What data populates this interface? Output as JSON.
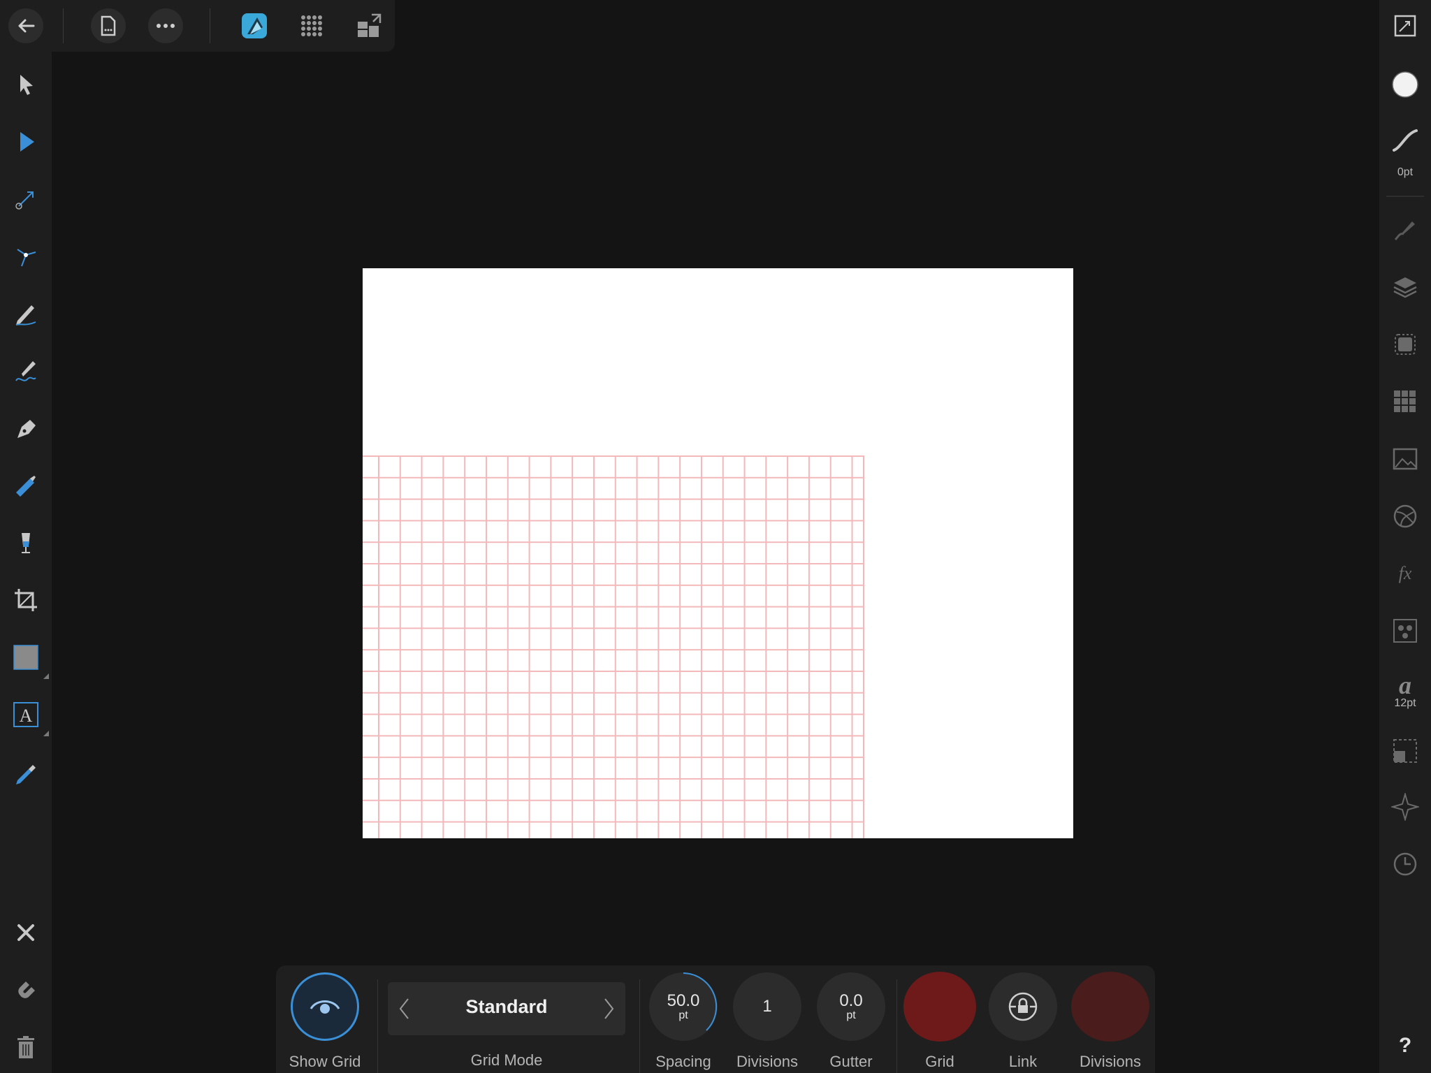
{
  "app": {
    "accent": "#3aa8d8"
  },
  "top_toolbar": {
    "icons": [
      "back-arrow-icon",
      "document-icon",
      "more-icon",
      "designer-persona-icon",
      "pixel-persona-icon",
      "export-persona-icon"
    ]
  },
  "left_tools": {
    "icons": [
      "move-tool-icon",
      "node-tool-icon",
      "contour-tool-icon",
      "corner-tool-icon",
      "pencil-tool-icon",
      "vector-brush-icon",
      "pen-tool-icon",
      "fill-tool-icon",
      "transparency-tool-icon",
      "crop-tool-icon",
      "rectangle-tool-icon",
      "artistic-text-icon",
      "color-picker-icon",
      "close-icon",
      "snapping-magnet-icon",
      "delete-icon"
    ]
  },
  "right_studio": {
    "stroke_width": "0pt",
    "font_size": "12pt",
    "help_label": "?",
    "fill_color": "#f2f2f2",
    "icons": [
      "fullscreen-icon",
      "color-icon",
      "stroke-icon",
      "brushes-icon",
      "layers-icon",
      "appearance-icon",
      "swatches-icon",
      "image-icon",
      "effects-icon",
      "fx-icon",
      "styles-icon",
      "text-styles-icon",
      "transform-icon",
      "navigator-icon",
      "history-icon"
    ]
  },
  "grid_panel": {
    "show_grid_label": "Show Grid",
    "grid_mode_label": "Grid Mode",
    "grid_mode_value": "Standard",
    "spacing_value": "50.0",
    "spacing_unit": "pt",
    "spacing_label": "Spacing",
    "divisions_value": "1",
    "divisions_label": "Divisions",
    "gutter_value": "0.0",
    "gutter_unit": "pt",
    "gutter_label": "Gutter",
    "grid_color_label": "Grid",
    "grid_color": "#6e1a1a",
    "link_label": "Link",
    "divisions_color_label": "Divisions",
    "divisions_color": "#4a1c1c"
  }
}
